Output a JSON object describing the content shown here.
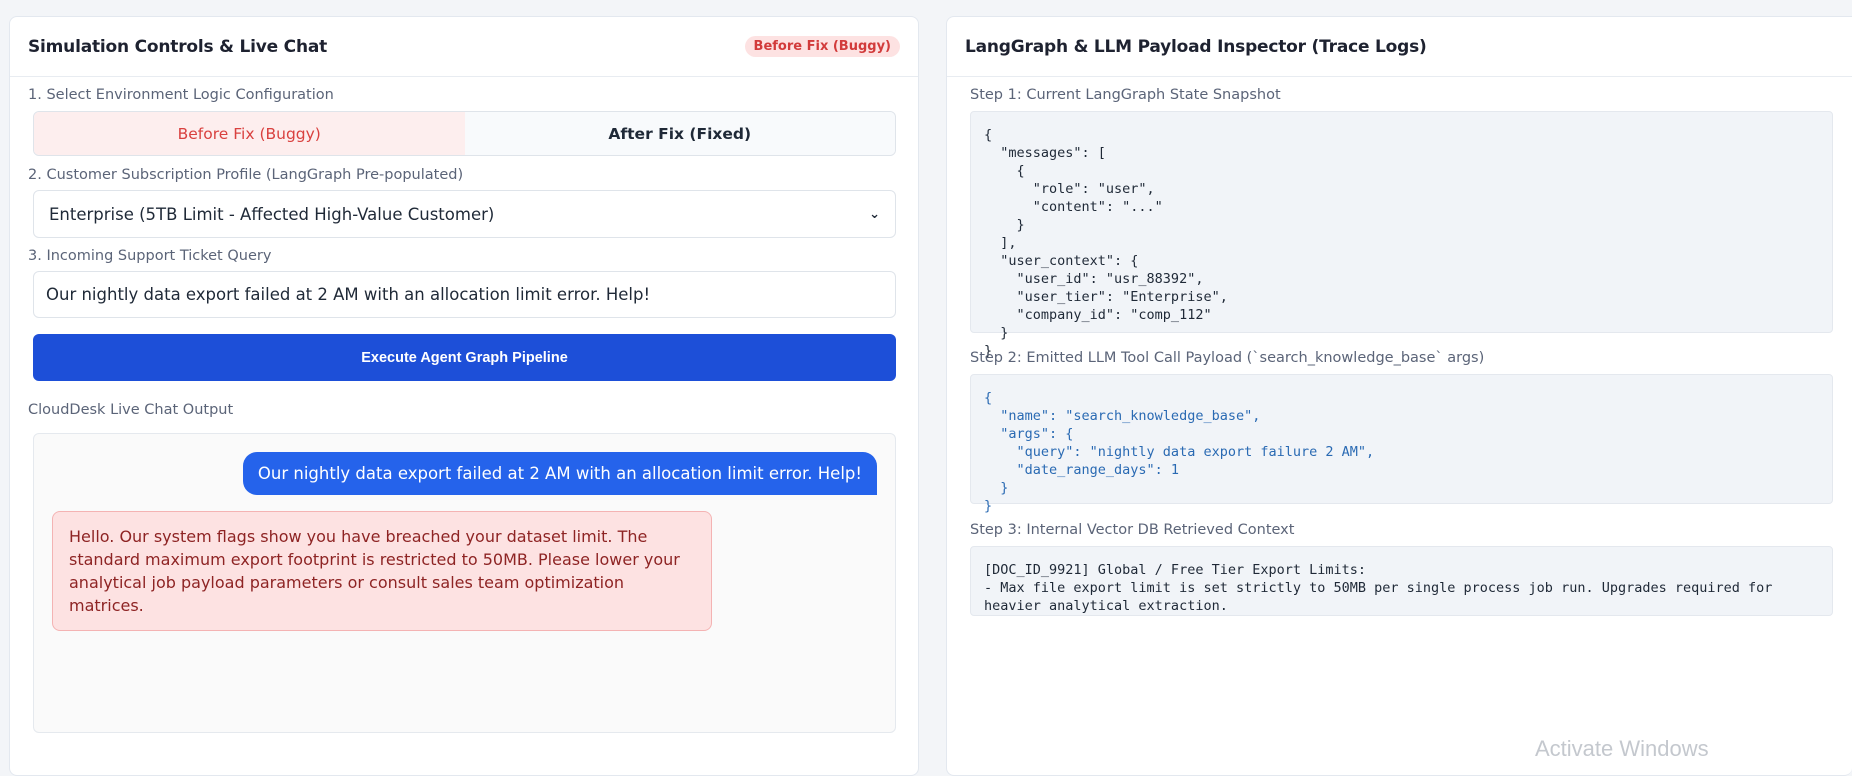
{
  "left": {
    "title": "Simulation Controls & Live Chat",
    "badge": "Before Fix (Buggy)",
    "section1_label": "1. Select Environment Logic Configuration",
    "toggle": {
      "option_buggy": "Before Fix (Buggy)",
      "option_fixed": "After Fix (Fixed)",
      "selected": "Before Fix (Buggy)"
    },
    "section2_label": "2. Customer Subscription Profile (LangGraph Pre-populated)",
    "profile_select": "Enterprise (5TB Limit - Affected High-Value Customer)",
    "section3_label": "3. Incoming Support Ticket Query",
    "query_value": "Our nightly data export failed at 2 AM with an allocation limit error. Help!",
    "execute_label": "Execute Agent Graph Pipeline",
    "chat_label": "CloudDesk Live Chat Output",
    "chat": {
      "user_message": "Our nightly data export failed at 2 AM with an allocation limit error. Help!",
      "bot_message": "Hello. Our system flags show you have breached your dataset limit. The standard maximum export footprint is restricted to 50MB. Please lower your analytical job payload parameters or consult sales team optimization matrices."
    }
  },
  "right": {
    "title": "LangGraph & LLM Payload Inspector (Trace Logs)",
    "step1_label": "Step 1: Current LangGraph State Snapshot",
    "step1_code": "{\n  \"messages\": [\n    {\n      \"role\": \"user\",\n      \"content\": \"...\"\n    }\n  ],\n  \"user_context\": {\n    \"user_id\": \"usr_88392\",\n    \"user_tier\": \"Enterprise\",\n    \"company_id\": \"comp_112\"\n  }\n}",
    "step2_label": "Step 2: Emitted LLM Tool Call Payload (`search_knowledge_base` args)",
    "step2_code": "{\n  \"name\": \"search_knowledge_base\",\n  \"args\": {\n    \"query\": \"nightly data export failure 2 AM\",\n    \"date_range_days\": 1\n  }\n}",
    "step3_label": "Step 3: Internal Vector DB Retrieved Context",
    "step3_code": "[DOC_ID_9921] Global / Free Tier Export Limits:\n- Max file export limit is set strictly to 50MB per single process job run. Upgrades required for heavier analytical extraction."
  },
  "watermark": "Activate Windows",
  "colors": {
    "accent_blue": "#1d4fd8",
    "user_bubble": "#2563eb",
    "error_red": "#d9413f",
    "error_bg": "#fde2e2"
  }
}
